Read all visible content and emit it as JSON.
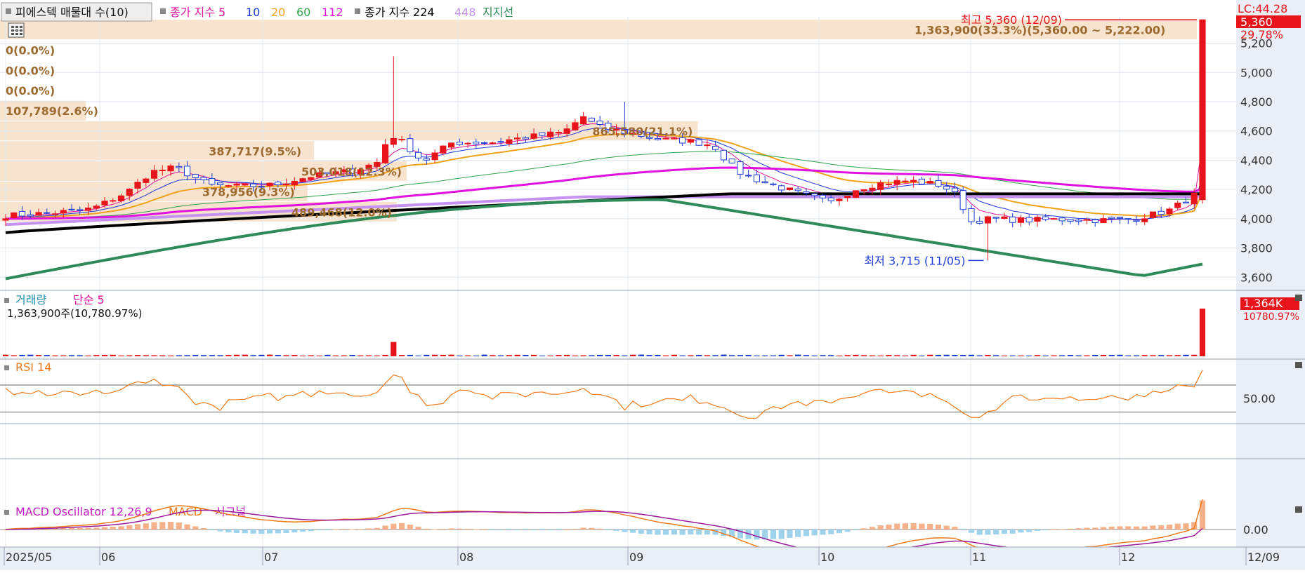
{
  "legend": {
    "title": "피에스텍 매물대 수(10)",
    "ma_prefix": "종가 지수",
    "ma_periods": [
      "5",
      "10",
      "20",
      "60",
      "112"
    ],
    "ma224": "종가 지수 224",
    "ma448": "448",
    "support_label": "지지선",
    "colors": [
      "#e0139e",
      "#1d35d8",
      "#f0a21a",
      "#2ea34a",
      "#e012e0"
    ]
  },
  "top_right": {
    "lc_label": "LC:44.28",
    "price_tag": "5,360",
    "change_tag": "29.78%"
  },
  "annotations": {
    "high": "최고 5,360 (12/09)",
    "low": "최저 3,715 (11/05)"
  },
  "volume_profile": [
    {
      "label": "1,363,900(33.3%)(5,360.00 ~ 5,222.00)",
      "price_top": 5360,
      "price_bottom": 5222,
      "pct": 33.3,
      "label_pos": "right"
    },
    {
      "label": "0(0.0%)",
      "price_top": 5222,
      "price_bottom": 5082,
      "pct": 0.0,
      "label_pos": "left"
    },
    {
      "label": "0(0.0%)",
      "price_top": 5082,
      "price_bottom": 4945,
      "pct": 0.0,
      "label_pos": "left"
    },
    {
      "label": "0(0.0%)",
      "price_top": 4945,
      "price_bottom": 4806,
      "pct": 0.0,
      "label_pos": "left"
    },
    {
      "label": "107,789(2.6%)",
      "price_top": 4806,
      "price_bottom": 4667,
      "pct": 2.6,
      "label_pos": "left"
    },
    {
      "label": "865,580(21.1%)",
      "price_top": 4667,
      "price_bottom": 4530,
      "pct": 21.1,
      "label_pos": "right"
    },
    {
      "label": "387,717(9.5%)",
      "price_top": 4530,
      "price_bottom": 4392,
      "pct": 9.5,
      "label_pos": "right"
    },
    {
      "label": "503,018(12.3%)",
      "price_top": 4392,
      "price_bottom": 4253,
      "pct": 12.3,
      "label_pos": "right"
    },
    {
      "label": "378,956(9.3%)",
      "price_top": 4253,
      "price_bottom": 4115,
      "pct": 9.3,
      "label_pos": "right"
    },
    {
      "label": "489,468(12.0%)",
      "price_top": 4115,
      "price_bottom": 3976,
      "pct": 12.0,
      "label_pos": "right"
    }
  ],
  "chart_data": [
    {
      "type": "candlestick",
      "title": "피에스텍",
      "y_axis": {
        "ticks": [
          "3,600",
          "3,800",
          "4,000",
          "4,200",
          "4,400",
          "4,600",
          "4,800",
          "5,000",
          "5,200"
        ],
        "range": [
          3520,
          5380
        ],
        "side": "right"
      },
      "x_axis": {
        "labels": [
          "2025/05",
          "06",
          "07",
          "08",
          "09",
          "10",
          "11",
          "12",
          "12/09"
        ]
      },
      "high": 5360,
      "low": 3715,
      "last_close": 5360,
      "change_percent": 29.78,
      "grid": true
    },
    {
      "type": "bar",
      "title": "거래량",
      "series_label": "단순 5",
      "value_label": "1,363,900주(10,780.97%)",
      "last_tag": "1,364K",
      "last_pct_tag": "10780.97%",
      "last_volume": 1363900
    },
    {
      "type": "line",
      "title": "RSI 14",
      "y_axis": {
        "ticks": [
          "50.00"
        ],
        "reference_lines": [
          70,
          30
        ]
      }
    },
    {
      "type": "line",
      "title": "MACD Oscillator 12,26,9",
      "series": [
        {
          "name": "MACD"
        },
        {
          "name": "시그널"
        }
      ],
      "y_axis": {
        "ticks": [
          "0.00"
        ]
      }
    }
  ]
}
